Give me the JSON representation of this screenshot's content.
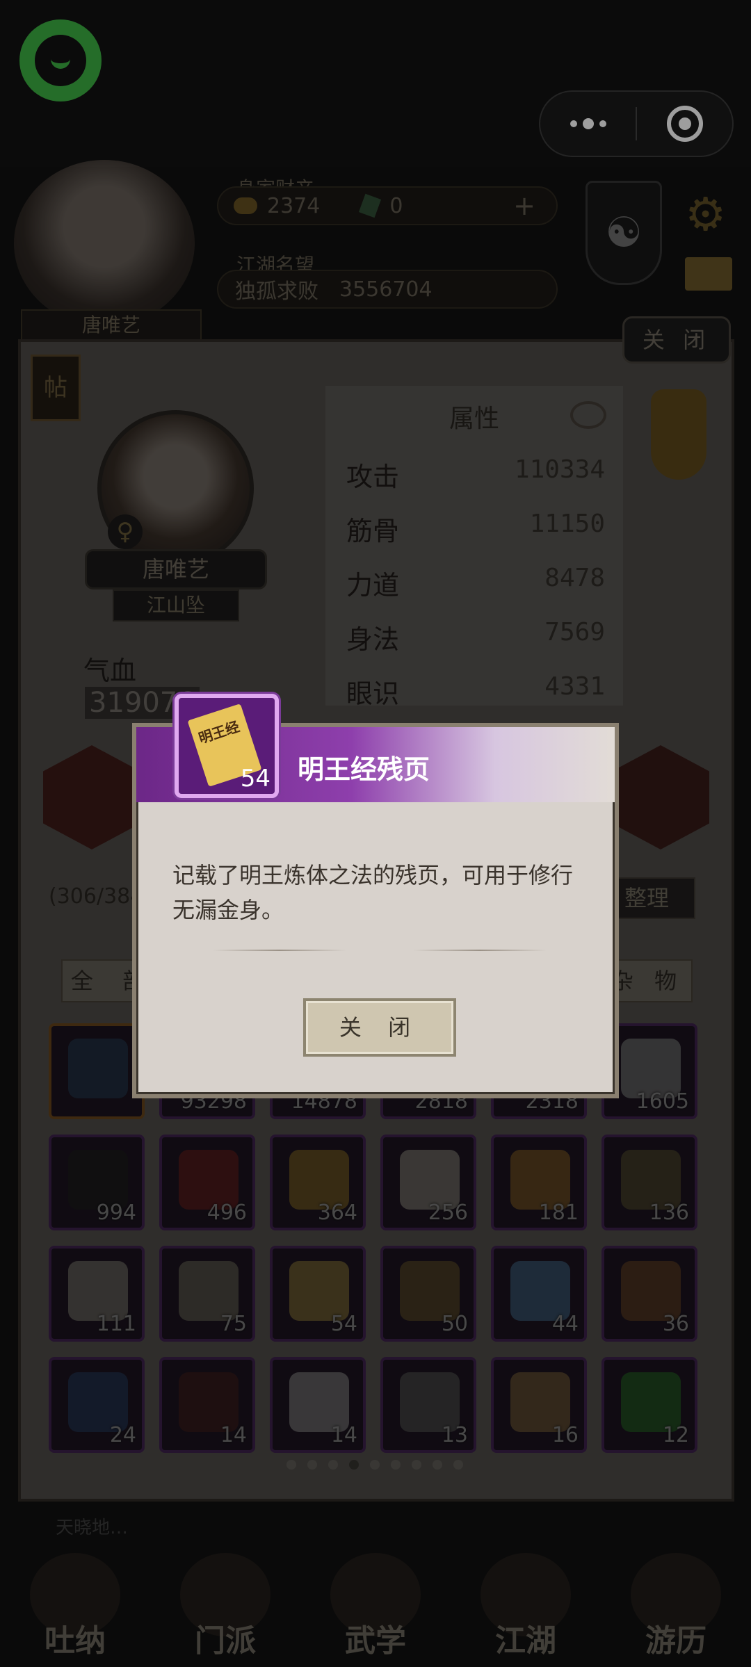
{
  "header": {
    "wealth_label": "身家财产",
    "gold": "2374",
    "jade": "0",
    "fame_label": "江湖名望",
    "fame_title": "独孤求败",
    "fame_value": "3556704",
    "top_name": "唐唯艺"
  },
  "panel": {
    "close_label": "关 闭",
    "post_label": "帖",
    "char_name": "唐唯艺",
    "char_title": "江山坠",
    "hp_label": "气血",
    "hp_value": "319076",
    "attr_title": "属性",
    "attributes": [
      {
        "name": "攻击",
        "value": "110334"
      },
      {
        "name": "筋骨",
        "value": "11150"
      },
      {
        "name": "力道",
        "value": "8478"
      },
      {
        "name": "身法",
        "value": "7569"
      },
      {
        "name": "眼识",
        "value": "4331"
      }
    ],
    "bag_count": "(306/384)",
    "sort_label": "整理",
    "filter_all": "全 部",
    "filter_misc": "杂 物"
  },
  "inventory": [
    {
      "count": "",
      "color": "#3a5a8a"
    },
    {
      "count": "93298",
      "color": "#8a6a3a"
    },
    {
      "count": "14878",
      "color": "#6a6a6a"
    },
    {
      "count": "2818",
      "color": "#8a5a3a"
    },
    {
      "count": "2318",
      "color": "#6a4a6a"
    },
    {
      "count": "1605",
      "color": "#cfcfcf"
    },
    {
      "count": "994",
      "color": "#2a2a2a"
    },
    {
      "count": "496",
      "color": "#b02a2a"
    },
    {
      "count": "364",
      "color": "#d8a83a"
    },
    {
      "count": "256",
      "color": "#e8e0d0"
    },
    {
      "count": "181",
      "color": "#d8963a"
    },
    {
      "count": "136",
      "color": "#8a7a4a"
    },
    {
      "count": "111",
      "color": "#cfc8b8"
    },
    {
      "count": "75",
      "color": "#b0a890"
    },
    {
      "count": "54",
      "color": "#e8c45a"
    },
    {
      "count": "50",
      "color": "#a08040"
    },
    {
      "count": "44",
      "color": "#6aa8e0"
    },
    {
      "count": "36",
      "color": "#a86a3a"
    },
    {
      "count": "24",
      "color": "#3a5a9a"
    },
    {
      "count": "14",
      "color": "#6a2a2a"
    },
    {
      "count": "14",
      "color": "#e0e0e0"
    },
    {
      "count": "13",
      "color": "#8a8a8a"
    },
    {
      "count": "16",
      "color": "#c89a5a"
    },
    {
      "count": "12",
      "color": "#3aa83a"
    }
  ],
  "tip": "天晓地…",
  "bottom_nav": [
    "吐纳",
    "门派",
    "武学",
    "江湖",
    "游历"
  ],
  "dialog": {
    "title": "明王经残页",
    "item_label": "明王经",
    "count": "54",
    "description": "记载了明王炼体之法的残页，可用于修行无漏金身。",
    "close_label": "关 闭"
  }
}
